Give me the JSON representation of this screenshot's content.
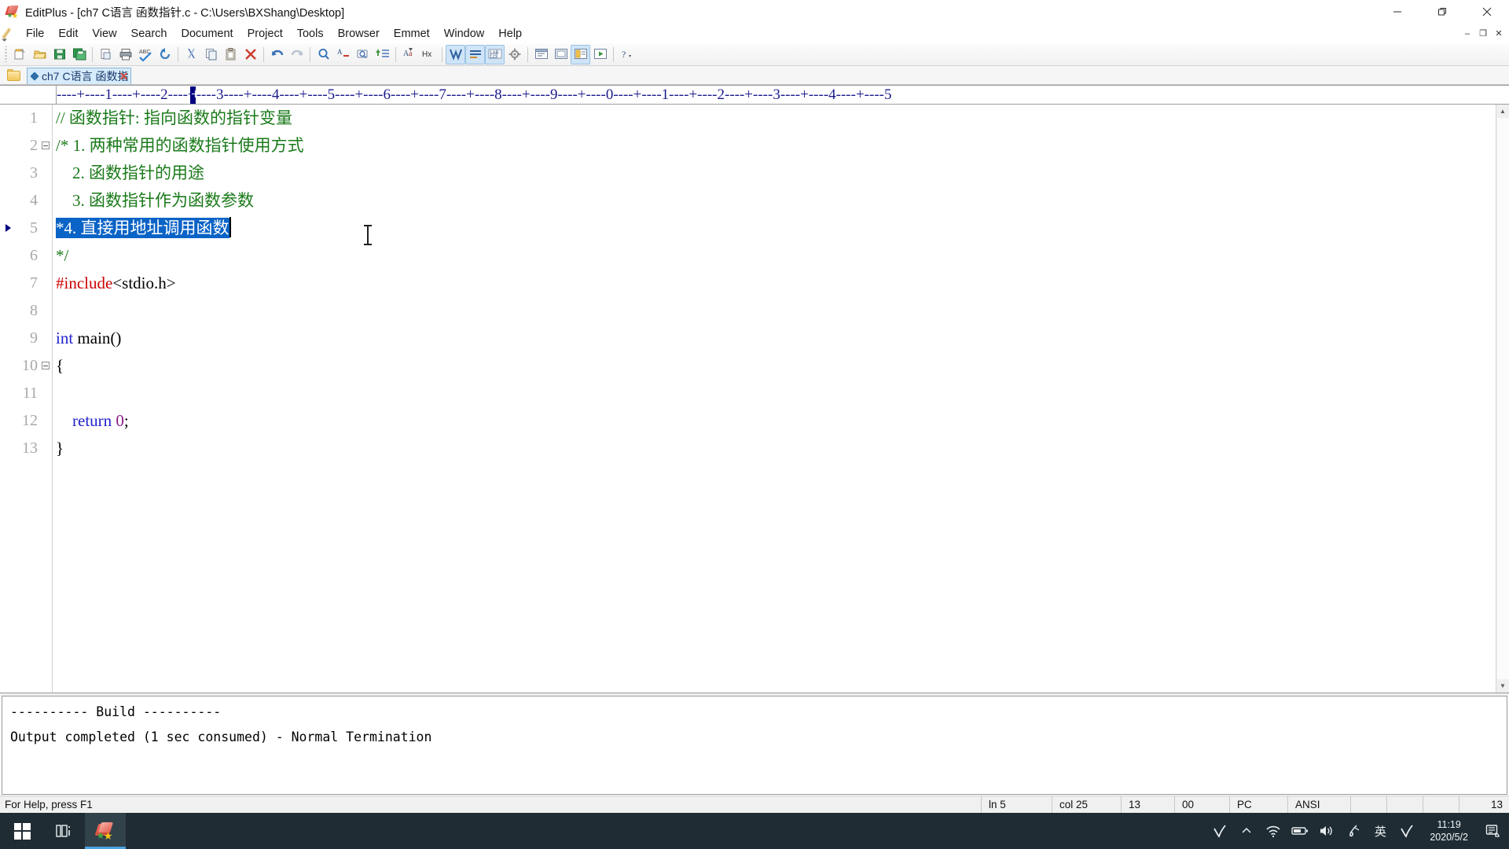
{
  "window": {
    "title": "EditPlus - [ch7 C语言 函数指针.c - C:\\Users\\BXShang\\Desktop]",
    "app_icon": "editplus-icon",
    "minimize": "–",
    "maximize": "□",
    "close": "✕"
  },
  "menubar": {
    "items": [
      {
        "label": "File"
      },
      {
        "label": "Edit"
      },
      {
        "label": "View"
      },
      {
        "label": "Search"
      },
      {
        "label": "Document"
      },
      {
        "label": "Project"
      },
      {
        "label": "Tools"
      },
      {
        "label": "Browser"
      },
      {
        "label": "Emmet"
      },
      {
        "label": "Window"
      },
      {
        "label": "Help"
      }
    ],
    "mdi": {
      "minimize": "–",
      "restore": "❐",
      "close": "✕"
    }
  },
  "toolbar": {
    "groups": [
      [
        "new-file-icon",
        "open-file-icon",
        "save-file-icon",
        "save-all-icon"
      ],
      [
        "print-preview-icon",
        "print-icon",
        "spellcheck-icon",
        "reload-icon"
      ],
      [
        "cut-icon",
        "copy-icon",
        "paste-icon",
        "delete-icon"
      ],
      [
        "undo-icon",
        "redo-icon"
      ],
      [
        "find-icon",
        "replace-icon",
        "find-in-files-icon",
        "goto-line-icon"
      ],
      [
        "word-wrap-icon",
        "hex-viewer-icon"
      ],
      [
        "show-spaces-icon",
        "show-linebreaks-icon",
        "line-numbers-icon",
        "preferences-icon"
      ],
      [
        "browser-preview-icon",
        "user-tool-icon",
        "compile-icon",
        "run-icon"
      ],
      [
        "help-icon"
      ]
    ]
  },
  "tabbar": {
    "folder_icon": "folder-icon",
    "tabs": [
      {
        "label": "ch7 C语言 函数指",
        "modified_dot": "◆",
        "close": "✕",
        "active": true
      }
    ]
  },
  "ruler": {
    "text": "----+----1----+----2----+----3----+----4----+----5----+----6----+----7----+----8----+----9----+----0----+----1----+----2----+----3----+----4----+----5",
    "marker_column": 25,
    "marker_char": "+"
  },
  "editor": {
    "bookmark_line": 5,
    "fold_lines": [
      2,
      10
    ],
    "lines": [
      {
        "n": "1",
        "segments": [
          {
            "t": "// 函数指针: 指向函数的指针变量",
            "c": "comment"
          }
        ]
      },
      {
        "n": "2",
        "segments": [
          {
            "t": "/* 1. 两种常用的函数指针使用方式",
            "c": "comment"
          }
        ]
      },
      {
        "n": "3",
        "segments": [
          {
            "t": "    2. 函数指针的用途",
            "c": "comment"
          }
        ]
      },
      {
        "n": "4",
        "segments": [
          {
            "t": "    3. 函数指针作为函数参数",
            "c": "comment"
          }
        ]
      },
      {
        "n": "5",
        "segments": [
          {
            "t": "*4. 直接用地址调用函数",
            "c": "selected"
          }
        ]
      },
      {
        "n": "6",
        "segments": [
          {
            "t": "*/",
            "c": "comment"
          }
        ]
      },
      {
        "n": "7",
        "segments": [
          {
            "t": "#include",
            "c": "pre"
          },
          {
            "t": "<stdio.h>",
            "c": "plain"
          }
        ]
      },
      {
        "n": "8",
        "segments": [
          {
            "t": "",
            "c": "plain"
          }
        ]
      },
      {
        "n": "9",
        "segments": [
          {
            "t": "int",
            "c": "kw"
          },
          {
            "t": " main()",
            "c": "plain"
          }
        ]
      },
      {
        "n": "10",
        "segments": [
          {
            "t": "{",
            "c": "plain"
          }
        ]
      },
      {
        "n": "11",
        "segments": [
          {
            "t": "",
            "c": "plain"
          }
        ]
      },
      {
        "n": "12",
        "segments": [
          {
            "t": "    ",
            "c": "plain"
          },
          {
            "t": "return",
            "c": "kw"
          },
          {
            "t": " ",
            "c": "plain"
          },
          {
            "t": "0",
            "c": "num"
          },
          {
            "t": ";",
            "c": "plain"
          }
        ]
      },
      {
        "n": "13",
        "segments": [
          {
            "t": "}",
            "c": "plain"
          }
        ]
      }
    ],
    "colors": {
      "comment": "#1a7a1a",
      "preprocessor": "#cc0000",
      "keyword": "#2222cc",
      "number": "#8a1a8a",
      "plain": "#000000",
      "selection_bg": "#0a63c6",
      "gutter": "#a8a8a8"
    }
  },
  "output": {
    "line1": "---------- Build ----------",
    "line2": "Output completed (1 sec consumed) - Normal Termination"
  },
  "statusbar": {
    "help": "For Help, press F1",
    "line": "ln 5",
    "col": "col 25",
    "char": "13",
    "sel": "00",
    "eol": "PC",
    "encoding": "ANSI",
    "blank1": "",
    "blank2": "",
    "blank3": "",
    "total": "13"
  },
  "taskbar": {
    "start": "windows-start-icon",
    "taskview": "task-view-icon",
    "apps": [
      {
        "name": "editplus-taskbar-icon",
        "active": true
      }
    ],
    "tray": [
      {
        "name": "pen-check-icon",
        "glyph": "✓"
      },
      {
        "name": "show-hidden-icons-chevron",
        "glyph": "^"
      },
      {
        "name": "wifi-icon",
        "glyph": "wifi"
      },
      {
        "name": "battery-icon",
        "glyph": "battery"
      },
      {
        "name": "volume-icon",
        "glyph": "volume"
      },
      {
        "name": "ime-pen-icon",
        "glyph": "pen"
      },
      {
        "name": "ime-language-icon",
        "glyph": "英"
      },
      {
        "name": "ime-check-icon",
        "glyph": "✓"
      }
    ],
    "clock": {
      "time": "11:19",
      "date": "2020/5/2"
    },
    "notifications": "action-center-icon"
  }
}
